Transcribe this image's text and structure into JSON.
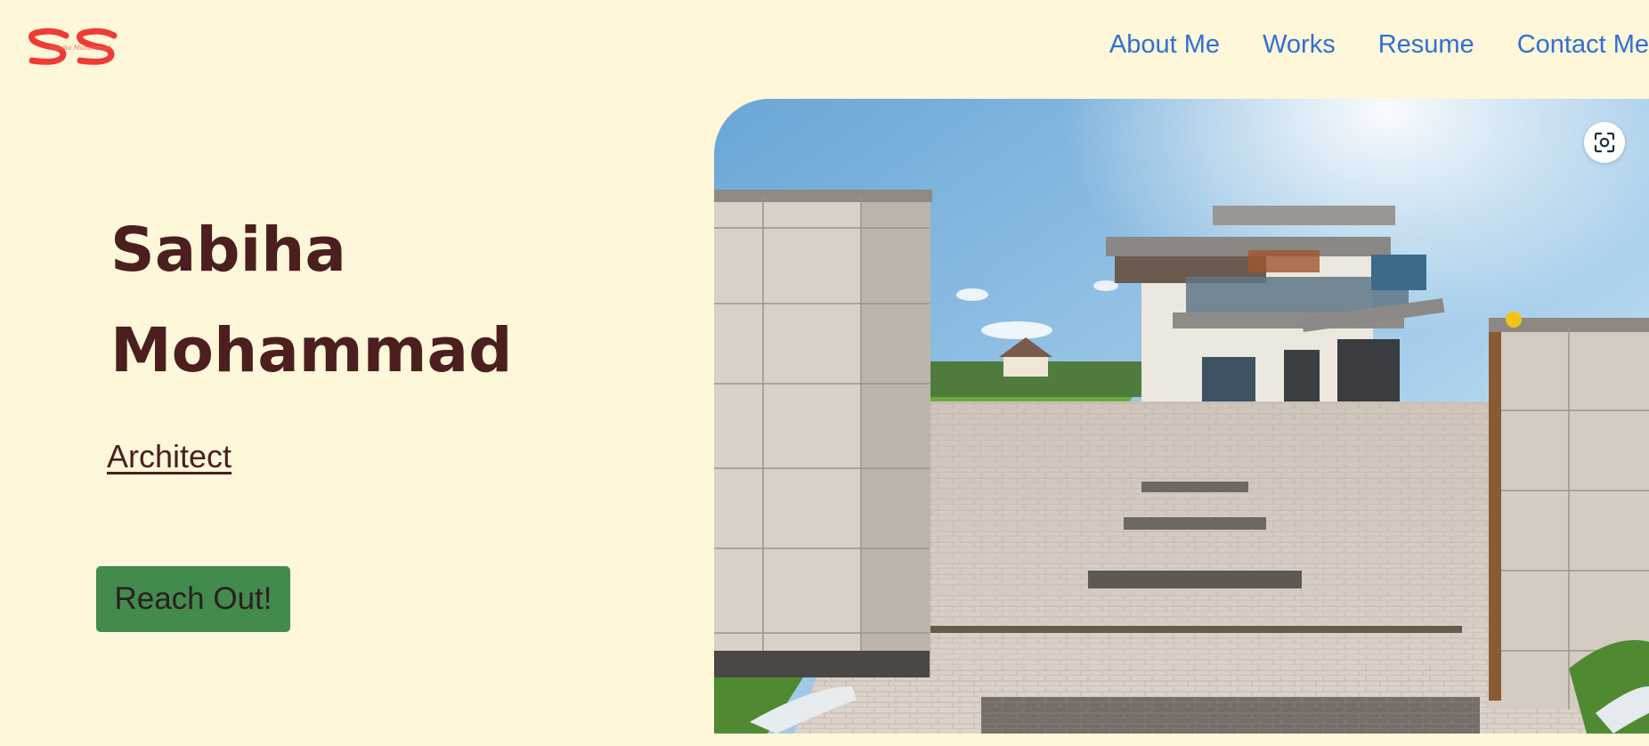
{
  "header": {
    "logo_initials": "SS",
    "logo_script": "Sabiha Mohammad",
    "nav": [
      {
        "label": "About Me"
      },
      {
        "label": "Works"
      },
      {
        "label": "Resume"
      },
      {
        "label": "Contact Me"
      }
    ]
  },
  "hero": {
    "first_name": "Sabiha",
    "last_name": "Mohammad",
    "role": "Architect",
    "cta_label": "Reach Out!",
    "image_alt": "Modern two-storey house with paved driveway behind stone gate pillars"
  },
  "icons": {
    "visual_search": "scan-icon"
  },
  "colors": {
    "page_background": "#fef7d9",
    "heading": "#4b1f1f",
    "nav_link": "#2f6fd8",
    "button": "#438a4d",
    "logo": "#f03a35"
  }
}
